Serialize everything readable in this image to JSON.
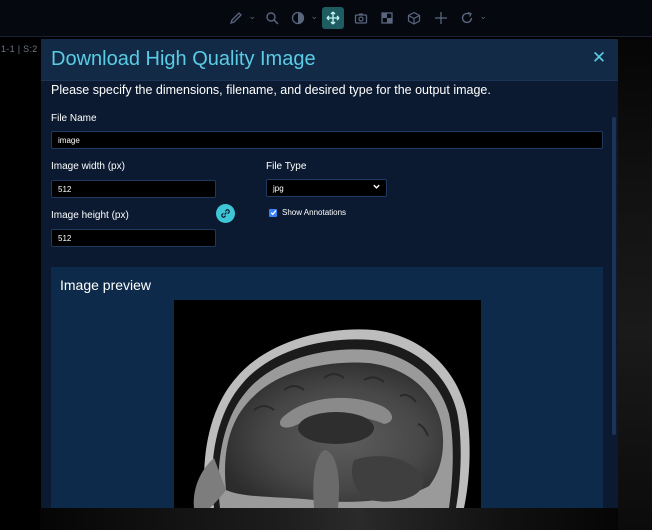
{
  "viewer": {
    "viewport_label": "1-1 | S:2",
    "toolbar_icons": [
      "pencil-icon",
      "search-icon",
      "contrast-icon",
      "pan-icon",
      "camera-icon",
      "grid-icon",
      "cube-icon",
      "crosshair-icon",
      "reset-icon"
    ],
    "active_tool": "pan-icon"
  },
  "modal": {
    "title": "Download High Quality Image",
    "close_icon": "close-icon",
    "instructions": "Please specify the dimensions, filename, and desired type for the output image.",
    "file_name": {
      "label": "File Name",
      "value": "image"
    },
    "width": {
      "label": "Image width (px)",
      "value": "512"
    },
    "height": {
      "label": "Image height (px)",
      "value": "512"
    },
    "link_icon": "link-icon",
    "file_type": {
      "label": "File Type",
      "selected": "jpg"
    },
    "annotations": {
      "label": "Show Annotations",
      "checked": true
    },
    "preview": {
      "title": "Image preview"
    }
  },
  "colors": {
    "modal_bg": "#0b1a30",
    "header_bg": "#122a45",
    "accent": "#5acce6",
    "link_button": "#3ec6d6",
    "checkbox": "#3b82f6",
    "preview_bg": "#0e2a4a"
  }
}
